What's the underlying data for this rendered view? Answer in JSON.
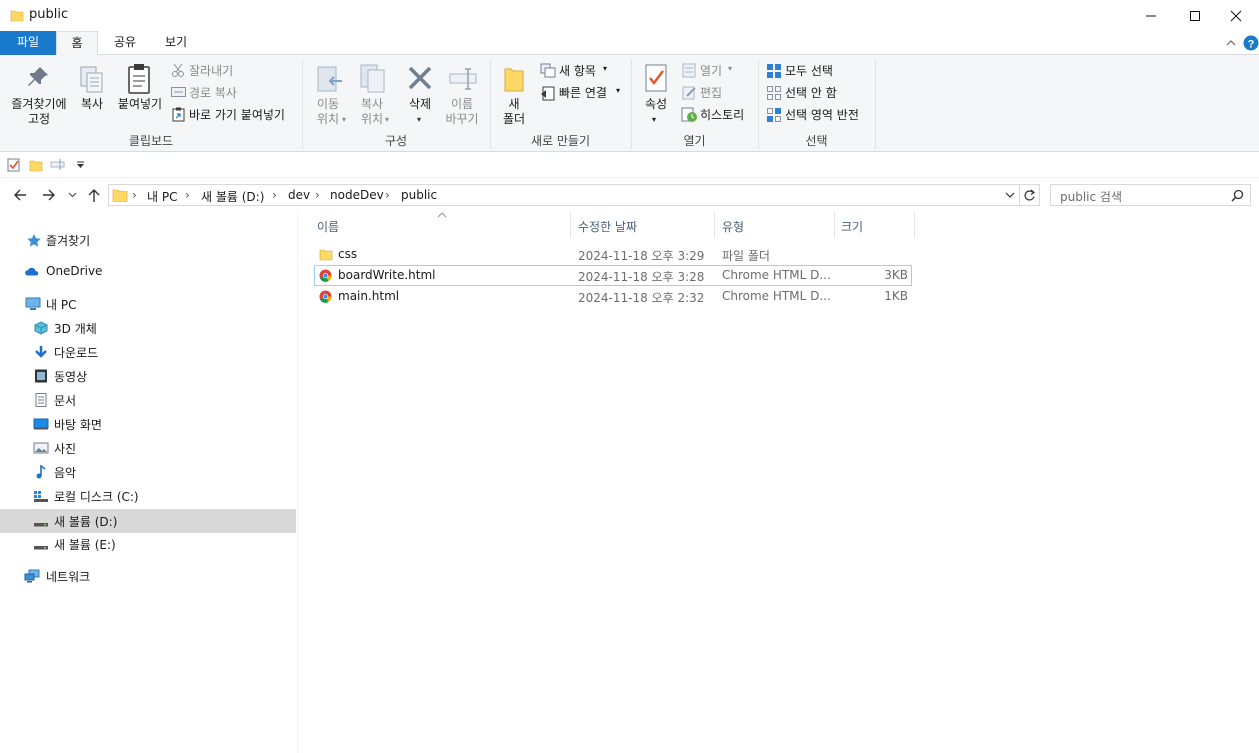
{
  "window": {
    "title": "public"
  },
  "tabs": [
    {
      "label": "파일"
    },
    {
      "label": "홈"
    },
    {
      "label": "공유"
    },
    {
      "label": "보기"
    }
  ],
  "ribbon": {
    "clipboard": {
      "pin_line1": "즐겨찾기에",
      "pin_line2": "고정",
      "copy": "복사",
      "paste": "붙여넣기",
      "cut": "잘라내기",
      "copy_path": "경로 복사",
      "paste_shortcut": "바로 가기 붙여넣기",
      "label": "클립보드"
    },
    "organize": {
      "move_line1": "이동",
      "move_line2": "위치",
      "copy_line1": "복사",
      "copy_line2": "위치",
      "delete": "삭제",
      "rename_line1": "이름",
      "rename_line2": "바꾸기",
      "label": "구성"
    },
    "new": {
      "folder_line1": "새",
      "folder_line2": "폴더",
      "new_item": "새 항목",
      "easy_access": "빠른 연결",
      "label": "새로 만들기"
    },
    "open": {
      "properties": "속성",
      "open": "열기",
      "edit": "편집",
      "history": "히스토리",
      "label": "열기"
    },
    "select": {
      "select_all": "모두 선택",
      "select_none": "선택 안 함",
      "invert": "선택 영역 반전",
      "label": "선택"
    }
  },
  "breadcrumb": [
    "내 PC",
    "새 볼륨 (D:)",
    "dev",
    "nodeDev",
    "public"
  ],
  "search": {
    "placeholder": "public 검색"
  },
  "nav": {
    "quick_access": "즐겨찾기",
    "onedrive": "OneDrive",
    "this_pc": "내 PC",
    "objects3d": "3D 개체",
    "downloads": "다운로드",
    "videos": "동영상",
    "documents": "문서",
    "desktop": "바탕 화면",
    "pictures": "사진",
    "music": "음악",
    "local_c": "로컬 디스크 (C:)",
    "vol_d": "새 볼륨 (D:)",
    "vol_e": "새 볼륨 (E:)",
    "network": "네트워크"
  },
  "columns": {
    "name": "이름",
    "modified": "수정한 날짜",
    "type": "유형",
    "size": "크기"
  },
  "files": [
    {
      "name": "css",
      "modified": "2024-11-18 오후 3:29",
      "type": "파일 폴더",
      "size": ""
    },
    {
      "name": "boardWrite.html",
      "modified": "2024-11-18 오후 3:28",
      "type": "Chrome HTML D...",
      "size": "3KB"
    },
    {
      "name": "main.html",
      "modified": "2024-11-18 오후 2:32",
      "type": "Chrome HTML D...",
      "size": "1KB"
    }
  ],
  "colors": {
    "accent": "#1979ca",
    "folder": "#ffd966",
    "selected_nav": "#d9d9d9",
    "selected_row_border": "#99d1ff"
  }
}
